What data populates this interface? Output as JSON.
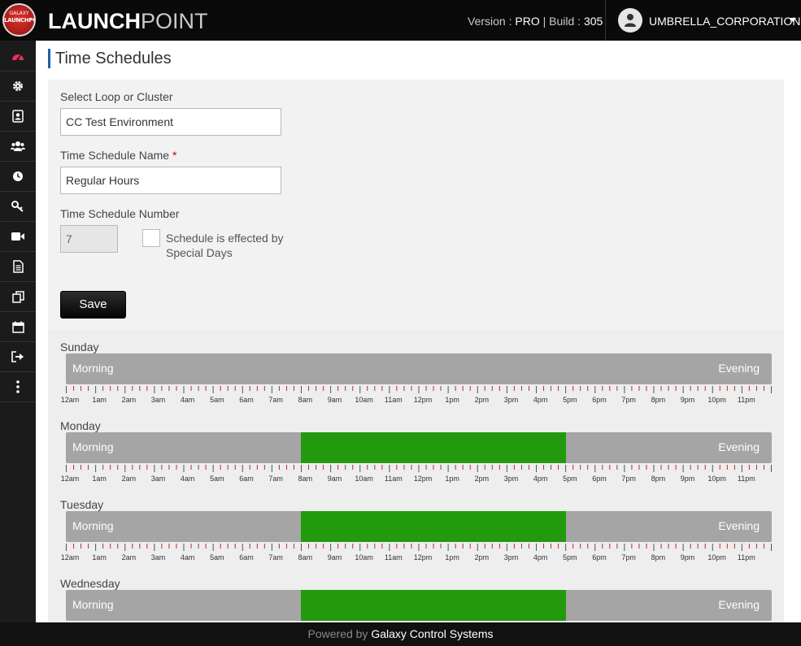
{
  "header": {
    "logo_top": "GALAXY",
    "logo_mid": "LAUNCHPOINT",
    "brand_bold": "LAUNCH",
    "brand_light": "POINT",
    "version_label": "Version :",
    "version_value": "PRO",
    "build_label": "| Build :",
    "build_value": "305",
    "user_name": "UMBRELLA_CORPORATION"
  },
  "sidebar": {
    "items": [
      {
        "icon": "dashboard-icon",
        "active": true
      },
      {
        "icon": "gear-icon"
      },
      {
        "icon": "contact-card-icon"
      },
      {
        "icon": "users-icon"
      },
      {
        "icon": "clock-icon"
      },
      {
        "icon": "key-icon"
      },
      {
        "icon": "video-camera-icon"
      },
      {
        "icon": "document-icon"
      },
      {
        "icon": "copy-icon"
      },
      {
        "icon": "calendar-icon"
      },
      {
        "icon": "sign-out-icon"
      },
      {
        "icon": "more-vertical-icon"
      }
    ]
  },
  "page": {
    "title": "Time Schedules"
  },
  "form": {
    "loop_label": "Select Loop or Cluster",
    "loop_value": "CC Test Environment",
    "name_label": "Time Schedule Name",
    "name_required": "*",
    "name_value": "Regular Hours",
    "number_label": "Time Schedule Number",
    "number_value": "7",
    "special_days_line1": "Schedule is effected by",
    "special_days_line2": "Special Days",
    "special_days_checked": false,
    "save_label": "Save"
  },
  "schedule": {
    "morning_label": "Morning",
    "evening_label": "Evening",
    "hours": [
      "12am",
      "1am",
      "2am",
      "3am",
      "4am",
      "5am",
      "6am",
      "7am",
      "8am",
      "9am",
      "10am",
      "11am",
      "12pm",
      "1pm",
      "2pm",
      "3pm",
      "4pm",
      "5pm",
      "6pm",
      "7pm",
      "8pm",
      "9pm",
      "10pm",
      "11pm"
    ],
    "days": [
      {
        "name": "Sunday",
        "active_ranges": []
      },
      {
        "name": "Monday",
        "active_ranges": [
          [
            8,
            17
          ]
        ]
      },
      {
        "name": "Tuesday",
        "active_ranges": [
          [
            8,
            17
          ]
        ]
      },
      {
        "name": "Wednesday",
        "active_ranges": [
          [
            8,
            17
          ]
        ]
      }
    ]
  },
  "colors": {
    "active": "#239a0e",
    "inactive": "#a5a5a5",
    "accent": "#1f5faa",
    "sidebar_active_icon": "#e8305a"
  },
  "footer": {
    "powered_by": "Powered by",
    "company": "Galaxy Control Systems"
  }
}
